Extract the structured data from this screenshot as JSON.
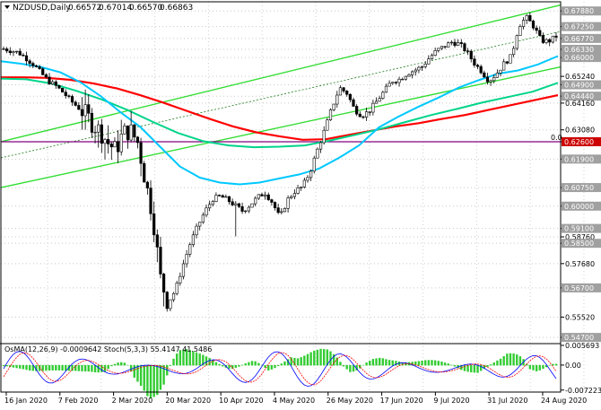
{
  "window": {
    "symbol": "NZDUSD,Daily",
    "ohlc": [
      "0.66572",
      "0.67014",
      "0.66570",
      "0.66863"
    ],
    "zero_label": "0.0"
  },
  "indicator_title": "OsMA(12,26,9) -0.0009642  Stoch(5,3,3) 55.4147 41.5486",
  "colors": {
    "candle": "#000000",
    "ema_fast": "#00c8ff",
    "ema_mid": "#00d48a",
    "ema_slow": "#ff0000",
    "channel": "#33dd33",
    "level_line": "#800080",
    "tag_red": "#cc0000",
    "tag_grey": "#a0a0a0",
    "osma": "#33cc33",
    "stoch_main": "#0000ff",
    "stoch_signal": "#ff0000"
  },
  "chart_data": {
    "type": "candlestick",
    "x_ticks": [
      "16 Jan 2020",
      "7 Feb 2020",
      "2 Mar 2020",
      "20 Mar 2020",
      "10 Apr 2020",
      "4 May 2020",
      "26 May 2020",
      "17 Jun 2020",
      "9 Jul 2020",
      "31 Jul 2020",
      "24 Aug 2020"
    ],
    "price_axis": [
      {
        "label": "0.67880",
        "value": 0.6788,
        "style": "grey"
      },
      {
        "label": "0.67250",
        "value": 0.6725,
        "style": "grey"
      },
      {
        "label": "0.66770",
        "value": 0.6677,
        "style": "grey"
      },
      {
        "label": "0.66330",
        "value": 0.6633,
        "style": "grey"
      },
      {
        "label": "0.66000",
        "value": 0.66,
        "style": "grey"
      },
      {
        "label": "0.65240",
        "value": 0.6524,
        "style": "plain"
      },
      {
        "label": "0.64900",
        "value": 0.649,
        "style": "grey"
      },
      {
        "label": "0.64440",
        "value": 0.6444,
        "style": "grey"
      },
      {
        "label": "0.64160",
        "value": 0.6416,
        "style": "plain"
      },
      {
        "label": "0.63080",
        "value": 0.6308,
        "style": "plain"
      },
      {
        "label": "0.62600",
        "value": 0.626,
        "style": "red"
      },
      {
        "label": "0.61900",
        "value": 0.619,
        "style": "grey"
      },
      {
        "label": "0.60750",
        "value": 0.6075,
        "style": "grey"
      },
      {
        "label": "0.60000",
        "value": 0.6,
        "style": "grey"
      },
      {
        "label": "0.59100",
        "value": 0.591,
        "style": "grey"
      },
      {
        "label": "0.58760",
        "value": 0.5876,
        "style": "plain"
      },
      {
        "label": "0.58500",
        "value": 0.585,
        "style": "grey"
      },
      {
        "label": "0.57680",
        "value": 0.5768,
        "style": "plain"
      },
      {
        "label": "0.56700",
        "value": 0.567,
        "style": "grey"
      },
      {
        "label": "0.55520",
        "value": 0.5552,
        "style": "plain"
      },
      {
        "label": "0.54700",
        "value": 0.547,
        "style": "grey"
      }
    ],
    "indicator_axis": [
      {
        "label": "0.005693",
        "value": 0.005693
      },
      {
        "label": "0.00",
        "value": 0
      },
      {
        "label": "-0.007223",
        "value": -0.007223
      }
    ],
    "horizontal_level": 0.626,
    "price_range": [
      0.5445,
      0.6825
    ],
    "indicator_range": [
      -0.0078,
      0.0062
    ],
    "close_path": [
      0.6635,
      0.6628,
      0.662,
      0.6598,
      0.6572,
      0.6538,
      0.6505,
      0.6485,
      0.6458,
      0.6425,
      0.6398,
      0.637,
      0.633,
      0.63,
      0.6255,
      0.6225,
      0.6295,
      0.6305,
      0.6255,
      0.61,
      0.596,
      0.571,
      0.561,
      0.566,
      0.576,
      0.585,
      0.592,
      0.598,
      0.6028,
      0.604,
      0.6025,
      0.6003,
      0.598,
      0.6005,
      0.6035,
      0.6055,
      0.6015,
      0.5952,
      0.6025,
      0.606,
      0.6078,
      0.6135,
      0.6225,
      0.6308,
      0.64,
      0.6478,
      0.6455,
      0.639,
      0.6365,
      0.6385,
      0.6425,
      0.6465,
      0.6505,
      0.6512,
      0.6535,
      0.6548,
      0.6562,
      0.6598,
      0.6628,
      0.6645,
      0.6662,
      0.6655,
      0.6625,
      0.6578,
      0.6545,
      0.6505,
      0.6535,
      0.6575,
      0.6605,
      0.6728,
      0.6762,
      0.6725,
      0.6668,
      0.6665,
      0.6686
    ],
    "ema_fast_path": [
      0.6585,
      0.6575,
      0.6562,
      0.654,
      0.65,
      0.6445,
      0.638,
      0.632,
      0.624,
      0.616,
      0.6115,
      0.6095,
      0.6088,
      0.6095,
      0.6112,
      0.6128,
      0.6152,
      0.6195,
      0.6245,
      0.6318,
      0.6362,
      0.6402,
      0.6438,
      0.6478,
      0.6508,
      0.6535,
      0.6548,
      0.6572,
      0.6606
    ],
    "ema_mid_path": [
      0.6515,
      0.6512,
      0.6495,
      0.6465,
      0.643,
      0.6388,
      0.634,
      0.6295,
      0.6262,
      0.6245,
      0.6238,
      0.624,
      0.6245,
      0.6265,
      0.6288,
      0.6312,
      0.634,
      0.6368,
      0.6392,
      0.6418,
      0.644,
      0.6462,
      0.6498
    ],
    "ema_slow_path": [
      0.652,
      0.652,
      0.6518,
      0.651,
      0.6495,
      0.6475,
      0.6448,
      0.6418,
      0.6385,
      0.6352,
      0.6322,
      0.6298,
      0.6282,
      0.6268,
      0.627,
      0.6288,
      0.6305,
      0.6322,
      0.6335,
      0.6352,
      0.6368,
      0.6388,
      0.6408,
      0.6428,
      0.6448
    ],
    "channel_upper": [
      0.626,
      0.6812
    ],
    "channel_mid": [
      0.6195,
      0.6705
    ],
    "channel_lower": [
      0.6075,
      0.6562
    ]
  }
}
